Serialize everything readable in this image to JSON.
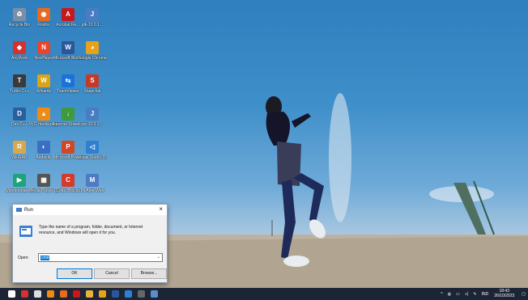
{
  "desktop": {
    "icons": [
      {
        "name": "recycle-bin-icon",
        "label": "Recycle Bin",
        "color": "#7a8fa6",
        "glyph": "♻"
      },
      {
        "name": "firefox-icon",
        "label": "Firefox",
        "color": "#e66a1f",
        "glyph": "◉"
      },
      {
        "name": "acrobat-icon",
        "label": "Acrobat Re...",
        "color": "#c8161d",
        "glyph": "A"
      },
      {
        "name": "shortcut-icon",
        "label": "jdk-10.0.1...",
        "color": "#4a7cc1",
        "glyph": "J"
      },
      {
        "name": "anydesk-icon",
        "label": "AnyDesk",
        "color": "#d6312f",
        "glyph": "◆"
      },
      {
        "name": "nox-player-icon",
        "label": "NoxPlayer",
        "color": "#e8452b",
        "glyph": "N"
      },
      {
        "name": "word-icon",
        "label": "Microsoft Word 2010",
        "color": "#2b579a",
        "glyph": "W"
      },
      {
        "name": "chrome-icon",
        "label": "Google Chrome",
        "color": "#e8a21a",
        "glyph": "◕"
      },
      {
        "name": "turbo-c-icon",
        "label": "Turbo C++",
        "color": "#3a3a3a",
        "glyph": "T"
      },
      {
        "name": "vlc-icon",
        "label": "Winamp",
        "color": "#d9a418",
        "glyph": "W"
      },
      {
        "name": "teamviewer-icon",
        "label": "TeamViewer",
        "color": "#1a73d9",
        "glyph": "⇆"
      },
      {
        "name": "snapchat-icon",
        "label": "Snapchat",
        "color": "#c23a2a",
        "glyph": "S"
      },
      {
        "name": "dev-cpp-icon",
        "label": "Dev-C++",
        "color": "#2a5f9e",
        "glyph": "D"
      },
      {
        "name": "vlc-media-icon",
        "label": "VLC media player",
        "color": "#f08a16",
        "glyph": "▲"
      },
      {
        "name": "internet-download-icon",
        "label": "Internet Downlo...",
        "color": "#3e9a3b",
        "glyph": "↓"
      },
      {
        "name": "jre-icon",
        "label": "jre-10.0.1...",
        "color": "#4a7cc1",
        "glyph": "J"
      },
      {
        "name": "winrar-icon",
        "label": "WinRAR",
        "color": "#d8a84a",
        "glyph": "R"
      },
      {
        "name": "audacity-icon",
        "label": "Audacity",
        "color": "#3b6fc4",
        "glyph": "◐"
      },
      {
        "name": "powerpoint-icon",
        "label": "Microsoft PowerPoi...",
        "color": "#d24726",
        "glyph": "P"
      },
      {
        "name": "visual-studio-icon",
        "label": "Visual Studio Code",
        "color": "#2f80d1",
        "glyph": "◁"
      },
      {
        "name": "wondershare-icon",
        "label": "Wondershare Filmora",
        "color": "#1fa37a",
        "glyph": "▶"
      },
      {
        "name": "media-player-icon",
        "label": "Media Player Classic",
        "color": "#555",
        "glyph": "▦"
      },
      {
        "name": "code-blocks-icon",
        "label": "Code::Blocks",
        "color": "#d63a2a",
        "glyph": "C"
      },
      {
        "name": "mcafee-icon",
        "label": "McAfee Web",
        "color": "#4d7bc4",
        "glyph": "M"
      }
    ]
  },
  "run_dialog": {
    "title": "Run",
    "message": "Type the name of a program, folder, document, or Internet resource, and Windows will open it for you.",
    "open_label": "Open:",
    "open_value": "cmd",
    "ok": "OK",
    "cancel": "Cancel",
    "browse": "Browse..."
  },
  "taskbar": {
    "apps": [
      {
        "name": "start-icon",
        "color": "#ffffff"
      },
      {
        "name": "app-icon",
        "color": "#d6312f"
      },
      {
        "name": "app-icon",
        "color": "#dddddd"
      },
      {
        "name": "vlc-icon",
        "color": "#f08a16"
      },
      {
        "name": "firefox-icon",
        "color": "#e66a1f"
      },
      {
        "name": "acrobat-icon",
        "color": "#c8161d"
      },
      {
        "name": "file-explorer-icon",
        "color": "#e8b23a"
      },
      {
        "name": "chrome-icon",
        "color": "#e8a21a"
      },
      {
        "name": "word-icon",
        "color": "#2b579a"
      },
      {
        "name": "visual-studio-icon",
        "color": "#2f80d1"
      },
      {
        "name": "run-app-icon",
        "color": "#666"
      },
      {
        "name": "run-active-icon",
        "color": "#5a8fcf"
      }
    ],
    "language": "IND",
    "time": "18:43",
    "date": "26/10/2023"
  }
}
